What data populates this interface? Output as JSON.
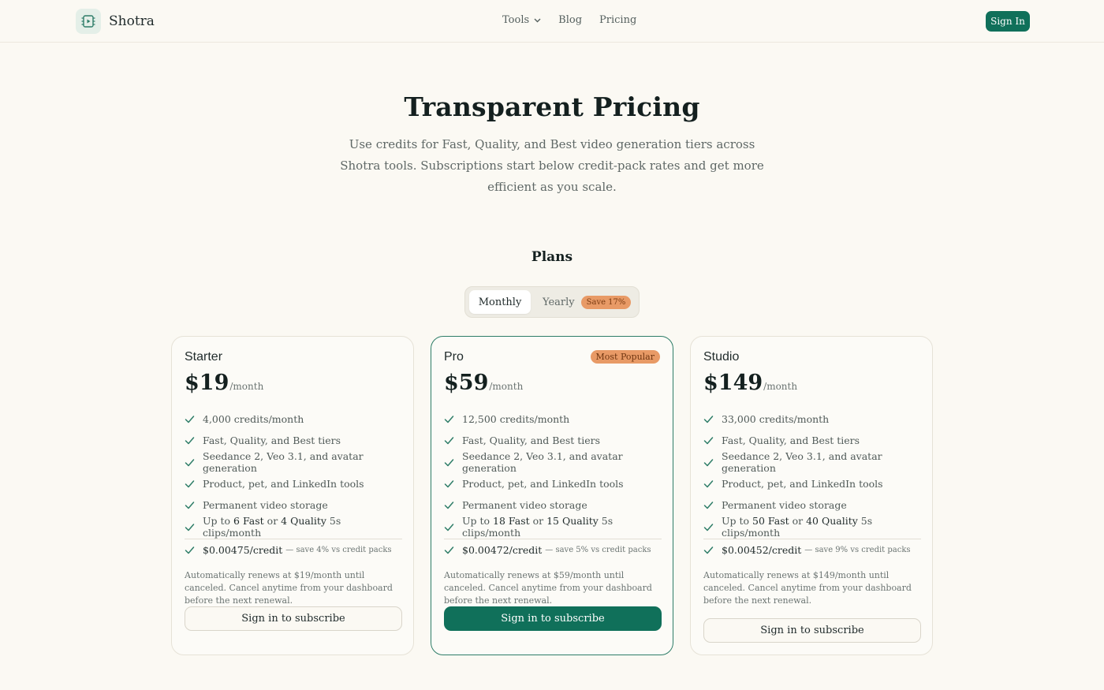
{
  "brand": {
    "name": "Shotra",
    "logo_icon": "film-icon"
  },
  "nav": {
    "items": [
      {
        "label": "Tools",
        "has_dropdown": true
      },
      {
        "label": "Blog"
      },
      {
        "label": "Pricing"
      }
    ],
    "signin_label": "Sign In"
  },
  "hero": {
    "title": "Transparent Pricing",
    "subtitle": "Use credits for Fast, Quality, and Best video generation tiers across Shotra tools. Subscriptions start below credit-pack rates and get more efficient as you scale."
  },
  "plans_title": "Plans",
  "billing_toggle": {
    "monthly_label": "Monthly",
    "yearly_label": "Yearly",
    "yearly_badge": "Save 17%",
    "selected": "Monthly"
  },
  "colors": {
    "accent": "#10705a",
    "badge": "#e89a66",
    "background": "#fbf9f3"
  },
  "plans": [
    {
      "name": "Starter",
      "price": "$19",
      "period": "/month",
      "badge": "",
      "features": [
        "4,000 credits/month",
        "Fast, Quality, and Best tiers",
        "Seedance 2, Veo 3.1, and avatar generation",
        "Product, pet, and LinkedIn tools",
        "Permanent video storage"
      ],
      "clips": {
        "prefix": "Up to ",
        "fast": "6 Fast",
        "mid": " or ",
        "quality": "4 Quality",
        "suffix": " 5s clips/month"
      },
      "credit_price": "$0.00475/credit",
      "credit_save": "— save 4% vs credit packs",
      "renew": "Automatically renews at $19/month until canceled. Cancel anytime from your dashboard before the next renewal.",
      "button": "Sign in to subscribe"
    },
    {
      "name": "Pro",
      "price": "$59",
      "period": "/month",
      "badge": "Most Popular",
      "features": [
        "12,500 credits/month",
        "Fast, Quality, and Best tiers",
        "Seedance 2, Veo 3.1, and avatar generation",
        "Product, pet, and LinkedIn tools",
        "Permanent video storage"
      ],
      "clips": {
        "prefix": "Up to ",
        "fast": "18 Fast",
        "mid": " or ",
        "quality": "15 Quality",
        "suffix": " 5s clips/month"
      },
      "credit_price": "$0.00472/credit",
      "credit_save": "— save 5% vs credit packs",
      "renew": "Automatically renews at $59/month until canceled. Cancel anytime from your dashboard before the next renewal.",
      "button": "Sign in to subscribe"
    },
    {
      "name": "Studio",
      "price": "$149",
      "period": "/month",
      "badge": "",
      "features": [
        "33,000 credits/month",
        "Fast, Quality, and Best tiers",
        "Seedance 2, Veo 3.1, and avatar generation",
        "Product, pet, and LinkedIn tools",
        "Permanent video storage"
      ],
      "clips": {
        "prefix": "Up to ",
        "fast": "50 Fast",
        "mid": " or ",
        "quality": "40 Quality",
        "suffix": " 5s clips/month"
      },
      "credit_price": "$0.00452/credit",
      "credit_save": "— save 9% vs credit packs",
      "renew": "Automatically renews at $149/month until canceled. Cancel anytime from your dashboard before the next renewal.",
      "button": "Sign in to subscribe"
    }
  ]
}
